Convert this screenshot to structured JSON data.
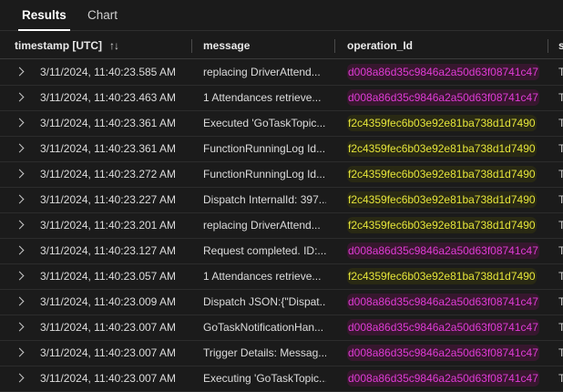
{
  "tabs": [
    {
      "label": "Results",
      "active": true
    },
    {
      "label": "Chart",
      "active": false
    }
  ],
  "columns": {
    "timestamp": "timestamp [UTC]",
    "message": "message",
    "operation_id": "operation_Id",
    "edge": "s"
  },
  "sort_icon": "↑↓",
  "colors": {
    "magenta_id": "#e03bd6",
    "yellow_id": "#e6e63a",
    "background": "#1b1b1b"
  },
  "rows": [
    {
      "timestamp": "3/11/2024, 11:40:23.585 AM",
      "message": "replacing DriverAttend...",
      "operation_id": "d008a86d35c9846a2a50d63f08741c47",
      "color": "magenta",
      "edge": "T"
    },
    {
      "timestamp": "3/11/2024, 11:40:23.463 AM",
      "message": "1 Attendances retrieve...",
      "operation_id": "d008a86d35c9846a2a50d63f08741c47",
      "color": "magenta",
      "edge": "T"
    },
    {
      "timestamp": "3/11/2024, 11:40:23.361 AM",
      "message": "Executed 'GoTaskTopic...",
      "operation_id": "f2c4359fec6b03e92e81ba738d1d7490",
      "color": "yellow",
      "edge": "T"
    },
    {
      "timestamp": "3/11/2024, 11:40:23.361 AM",
      "message": "FunctionRunningLog Id...",
      "operation_id": "f2c4359fec6b03e92e81ba738d1d7490",
      "color": "yellow",
      "edge": "T"
    },
    {
      "timestamp": "3/11/2024, 11:40:23.272 AM",
      "message": "FunctionRunningLog Id...",
      "operation_id": "f2c4359fec6b03e92e81ba738d1d7490",
      "color": "yellow",
      "edge": "T"
    },
    {
      "timestamp": "3/11/2024, 11:40:23.227 AM",
      "message": "Dispatch InternalId: 397...",
      "operation_id": "f2c4359fec6b03e92e81ba738d1d7490",
      "color": "yellow",
      "edge": "T"
    },
    {
      "timestamp": "3/11/2024, 11:40:23.201 AM",
      "message": "replacing DriverAttend...",
      "operation_id": "f2c4359fec6b03e92e81ba738d1d7490",
      "color": "yellow",
      "edge": "T"
    },
    {
      "timestamp": "3/11/2024, 11:40:23.127 AM",
      "message": "Request completed. ID:...",
      "operation_id": "d008a86d35c9846a2a50d63f08741c47",
      "color": "magenta",
      "edge": "T"
    },
    {
      "timestamp": "3/11/2024, 11:40:23.057 AM",
      "message": "1 Attendances retrieve...",
      "operation_id": "f2c4359fec6b03e92e81ba738d1d7490",
      "color": "yellow",
      "edge": "T"
    },
    {
      "timestamp": "3/11/2024, 11:40:23.009 AM",
      "message": "Dispatch JSON:{\"Dispat...",
      "operation_id": "d008a86d35c9846a2a50d63f08741c47",
      "color": "magenta",
      "edge": "T"
    },
    {
      "timestamp": "3/11/2024, 11:40:23.007 AM",
      "message": "GoTaskNotificationHan...",
      "operation_id": "d008a86d35c9846a2a50d63f08741c47",
      "color": "magenta",
      "edge": "T"
    },
    {
      "timestamp": "3/11/2024, 11:40:23.007 AM",
      "message": "Trigger Details: Messag...",
      "operation_id": "d008a86d35c9846a2a50d63f08741c47",
      "color": "magenta",
      "edge": "T"
    },
    {
      "timestamp": "3/11/2024, 11:40:23.007 AM",
      "message": "Executing 'GoTaskTopic...",
      "operation_id": "d008a86d35c9846a2a50d63f08741c47",
      "color": "magenta",
      "edge": "T"
    }
  ]
}
